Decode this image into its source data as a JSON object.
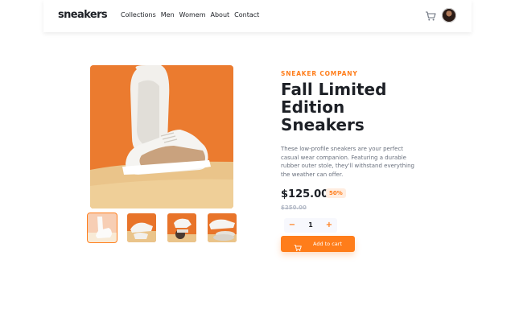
{
  "header": {
    "logo": "sneakers",
    "nav": [
      "Collections",
      "Men",
      "Womem",
      "About",
      "Contact"
    ]
  },
  "icons": {
    "cart": "cart-icon",
    "avatar": "user-avatar",
    "plus": "plus-icon",
    "minus": "minus-icon"
  },
  "product": {
    "company": "SNEAKER COMPANY",
    "title": "Fall Limited Edition Sneakers",
    "description": "These low-profile sneakers are your perfect casual wear companion. Featuring a durable rubber outer stole, they'll withstand everything the weather can offer.",
    "price": "$125.00",
    "discount": "50%",
    "original_price": "$250.00",
    "quantity": "1",
    "minus_label": "−",
    "plus_label": "+",
    "add_to_cart": "Add to cart"
  },
  "gallery": {
    "selected_thumbnail": 1,
    "thumbnail_count": 4
  },
  "colors": {
    "accent": "#ff7d1a",
    "accent_pale": "#ffede0",
    "text_dark": "#1d2026",
    "text_muted": "#69707d",
    "text_light": "#b6bcc8",
    "image_orange": "#e8742a",
    "image_sand": "#eac48a"
  }
}
